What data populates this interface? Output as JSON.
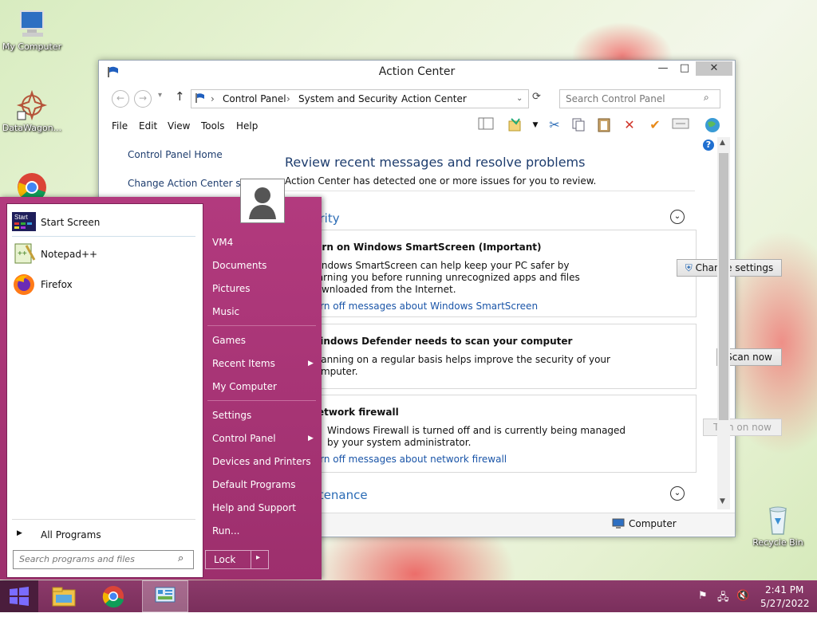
{
  "desktop": {
    "icons": [
      {
        "label": "My Computer",
        "icon": "computer-icon"
      },
      {
        "label": "DataWagon...",
        "icon": "datawagon-icon"
      },
      {
        "label": "",
        "icon": "chrome-icon"
      },
      {
        "label": "Recycle Bin",
        "icon": "recycle-bin-icon"
      }
    ]
  },
  "window": {
    "title": "Action Center",
    "controls": {
      "minimize": "—",
      "maximize": "□",
      "close": "✕"
    },
    "nav": {
      "back": "←",
      "forward": "→",
      "dropdown": "▾",
      "up": "↑"
    },
    "breadcrumb": [
      "Control Panel",
      "System and Security",
      "Action Center"
    ],
    "address_sep": "›",
    "search_placeholder": "Search Control Panel",
    "menu": [
      "File",
      "Edit",
      "View",
      "Tools",
      "Help"
    ],
    "left_nav": [
      "Control Panel Home",
      "Change Action Center setti"
    ],
    "heading": "Review recent messages and resolve problems",
    "subheading": "Action Center has detected one or more issues for you to review.",
    "security_title": "Security",
    "maintenance_title": "Maintenance",
    "smartscreen": {
      "title": "Turn on Windows SmartScreen  (Important)",
      "text1": "Windows SmartScreen can help keep your PC safer by",
      "text2": "warning you before running unrecognized apps and files",
      "text3": "downloaded from the Internet.",
      "link": "Turn off messages about Windows SmartScreen",
      "button": "Change settings"
    },
    "defender": {
      "title": "Windows Defender needs to scan your computer",
      "text1": "Scanning on a regular basis helps improve the security of your",
      "text2": "computer.",
      "button": "Scan now"
    },
    "firewall": {
      "title": "Network firewall",
      "text1": "Windows Firewall is turned off and is currently being managed",
      "text2": "by your system administrator.",
      "link": "Turn off messages about network firewall",
      "button": "Turn on now"
    },
    "status": "Computer"
  },
  "start_menu": {
    "pinned": [
      {
        "label": "Start Screen",
        "icon": "start-screen-icon"
      },
      {
        "label": "Notepad++",
        "icon": "notepad-plus-plus-icon"
      },
      {
        "label": "Firefox",
        "icon": "firefox-icon"
      }
    ],
    "all_programs": "All Programs",
    "search_placeholder": "Search programs and files",
    "right": [
      {
        "label": "VM4"
      },
      {
        "label": "Documents"
      },
      {
        "label": "Pictures"
      },
      {
        "label": "Music"
      },
      {
        "label": "Games"
      },
      {
        "label": "Recent Items"
      },
      {
        "label": "My Computer"
      },
      {
        "label": "Settings"
      },
      {
        "label": "Control Panel"
      },
      {
        "label": "Devices and Printers"
      },
      {
        "label": "Default Programs"
      },
      {
        "label": "Help and Support"
      },
      {
        "label": "Run..."
      }
    ],
    "lock": "Lock",
    "lock_arrow": "▸"
  },
  "taskbar": {
    "time": "2:41 PM",
    "date": "5/27/2022"
  }
}
